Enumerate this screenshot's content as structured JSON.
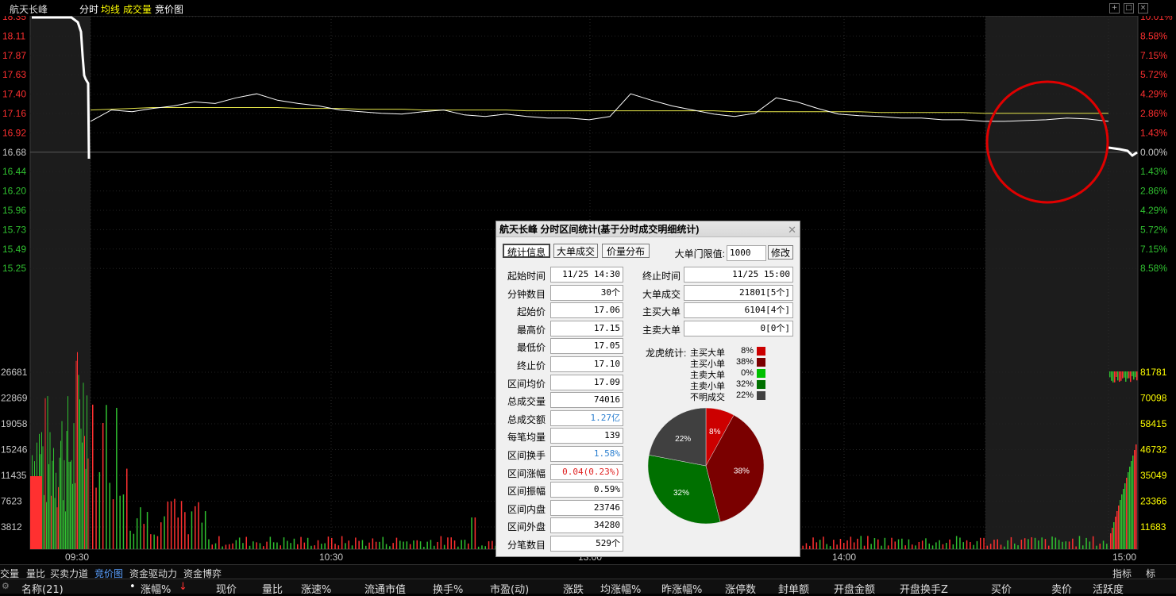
{
  "header": {
    "stock_name": "航天长峰",
    "tabs": [
      "分时",
      "均线",
      "成交量",
      "竞价图"
    ],
    "colors": {
      "tab_time": "#ffffff",
      "tab_avg": "#ffff00",
      "tab_vol": "#ffff00",
      "tab_bid": "#ffffff"
    }
  },
  "price_axis_left": [
    "18.35",
    "18.11",
    "17.87",
    "17.63",
    "17.40",
    "17.16",
    "16.92",
    "16.68",
    "16.44",
    "16.20",
    "15.96",
    "15.73",
    "15.49",
    "15.25"
  ],
  "price_axis_right": [
    "10.01%",
    "8.58%",
    "7.15%",
    "5.72%",
    "4.29%",
    "2.86%",
    "1.43%",
    "0.00%",
    "1.43%",
    "2.86%",
    "4.29%",
    "5.72%",
    "7.15%",
    "8.58%"
  ],
  "volume_axis_left": [
    "26681",
    "22869",
    "19058",
    "15246",
    "11435",
    "7623",
    "3812"
  ],
  "volume_axis_right": [
    "81781",
    "70098",
    "58415",
    "46732",
    "35049",
    "23366",
    "11683"
  ],
  "time_axis": [
    "09:30",
    "10:30",
    "13:00",
    "14:00",
    "15:00"
  ],
  "chart_data": {
    "type": "line",
    "title": "",
    "prev_close": 16.68,
    "ylim": [
      15.01,
      18.35
    ],
    "series": [
      {
        "name": "分时",
        "values": [
          17.06,
          17.2,
          17.18,
          17.22,
          17.25,
          17.3,
          17.28,
          17.35,
          17.4,
          17.32,
          17.28,
          17.25,
          17.2,
          17.18,
          17.16,
          17.15,
          17.18,
          17.2,
          17.14,
          17.12,
          17.15,
          17.12,
          17.1,
          17.1,
          17.08,
          17.12,
          17.4,
          17.32,
          17.25,
          17.2,
          17.15,
          17.12,
          17.16,
          17.35,
          17.3,
          17.22,
          17.15,
          17.13,
          17.12,
          17.1,
          17.1,
          17.08,
          17.08,
          17.06,
          17.06,
          17.07,
          17.08,
          17.1,
          17.09,
          17.06
        ]
      },
      {
        "name": "均线",
        "values": [
          17.2,
          17.21,
          17.22,
          17.23,
          17.23,
          17.23,
          17.23,
          17.23,
          17.23,
          17.23,
          17.22,
          17.22,
          17.22,
          17.21,
          17.21,
          17.21,
          17.2,
          17.2,
          17.2,
          17.2,
          17.2,
          17.19,
          17.19,
          17.19,
          17.19,
          17.19,
          17.19,
          17.19,
          17.19,
          17.19,
          17.19,
          17.18,
          17.18,
          17.18,
          17.18,
          17.18,
          17.18,
          17.18,
          17.17,
          17.17,
          17.17,
          17.17,
          17.17,
          17.16,
          17.16,
          17.16,
          17.16,
          17.16,
          17.16,
          17.16
        ]
      }
    ],
    "colors": {
      "price": "#ffffff",
      "avg": "#e6e64a",
      "up_pct": "#ff3030",
      "down_pct": "#30c030",
      "volume_up": "#ff3030",
      "volume_down": "#30c030",
      "circle": "#e00000"
    }
  },
  "dialog": {
    "title": "航天长峰 分时区间统计(基于分时成交明细统计)",
    "tabs": [
      "统计信息",
      "大单成交",
      "价量分布"
    ],
    "threshold_label": "大单门限值:",
    "threshold_value": "1000",
    "modify_label": "修改",
    "left_rows": [
      {
        "label": "起始时间",
        "value": "11/25 14:30",
        "style": ""
      },
      {
        "label": "分钟数目",
        "value": "30个",
        "style": ""
      },
      {
        "label": "起始价",
        "value": "17.06",
        "style": ""
      },
      {
        "label": "最高价",
        "value": "17.15",
        "style": ""
      },
      {
        "label": "最低价",
        "value": "17.05",
        "style": ""
      },
      {
        "label": "终止价",
        "value": "17.10",
        "style": ""
      },
      {
        "label": "区间均价",
        "value": "17.09",
        "style": ""
      },
      {
        "label": "总成交量",
        "value": "74016",
        "style": ""
      },
      {
        "label": "总成交额",
        "value": "1.27亿",
        "style": "blue"
      },
      {
        "label": "每笔均量",
        "value": "139",
        "style": ""
      },
      {
        "label": "区间换手",
        "value": "1.58%",
        "style": "blue"
      },
      {
        "label": "区间涨幅",
        "value": "0.04(0.23%)",
        "style": "red"
      },
      {
        "label": "区间振幅",
        "value": "0.59%",
        "style": ""
      },
      {
        "label": "区间内盘",
        "value": "23746",
        "style": ""
      },
      {
        "label": "区间外盘",
        "value": "34280",
        "style": ""
      },
      {
        "label": "分笔数目",
        "value": "529个",
        "style": ""
      }
    ],
    "right_rows": [
      {
        "label": "终止时间",
        "value": "11/25 15:00"
      },
      {
        "label": "大单成交",
        "value": "21801[5个]"
      },
      {
        "label": "主买大单",
        "value": "6104[4个]"
      },
      {
        "label": "主卖大单",
        "value": "0[0个]"
      }
    ],
    "legend_title": "龙虎统计:",
    "legend": [
      {
        "label": "主买大单",
        "pct": "8%",
        "color": "#cc0000"
      },
      {
        "label": "主买小单",
        "pct": "38%",
        "color": "#7a0000"
      },
      {
        "label": "主卖大单",
        "pct": "0%",
        "color": "#00c000"
      },
      {
        "label": "主卖小单",
        "pct": "32%",
        "color": "#007000"
      },
      {
        "label": "不明成交",
        "pct": "22%",
        "color": "#404040"
      }
    ],
    "pie": [
      {
        "label": "8%",
        "value": 8,
        "color": "#cc0000"
      },
      {
        "label": "38%",
        "value": 38,
        "color": "#7a0000"
      },
      {
        "label": "32%",
        "value": 32,
        "color": "#007000"
      },
      {
        "label": "22%",
        "value": 22,
        "color": "#404040"
      }
    ]
  },
  "bottom_tabs": [
    "交量",
    "量比",
    "买卖力道",
    "竞价图",
    "资金驱动力",
    "资金博弈"
  ],
  "bottom_right": [
    "指标",
    "标"
  ],
  "columns": [
    "名称(21)",
    "•",
    "涨幅%",
    "现价",
    "量比",
    "涨速%",
    "流通市值",
    "换手%",
    "市盈(动)",
    "涨跌",
    "均涨幅%",
    "昨涨幅%",
    "涨停数",
    "封单额",
    "开盘金额",
    "开盘换手Z",
    "买价",
    "卖价",
    "活跃度"
  ]
}
